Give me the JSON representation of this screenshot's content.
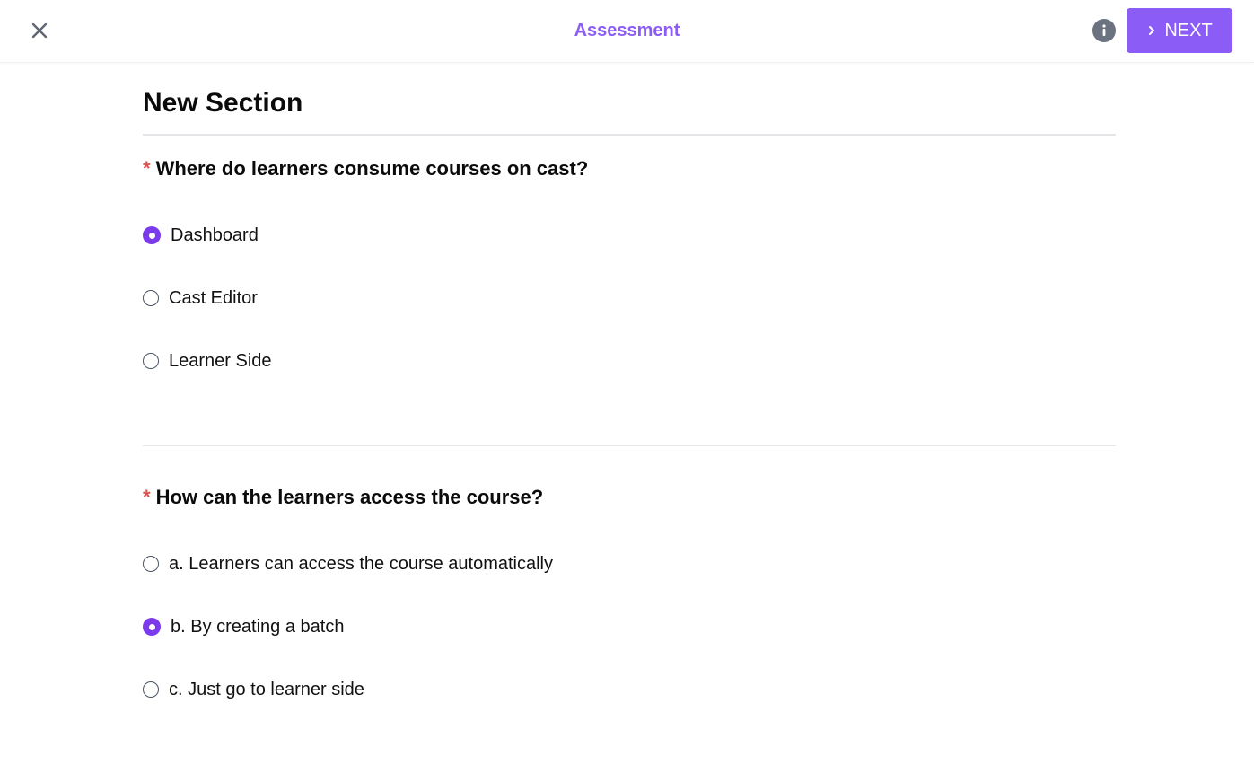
{
  "header": {
    "title": "Assessment",
    "next_label": "NEXT",
    "accent_color": "#8b5cf6",
    "close_icon": "close-icon",
    "info_icon": "info-icon",
    "next_icon": "chevron-right-icon"
  },
  "section": {
    "title": "New Section"
  },
  "questions": [
    {
      "required_marker": "*",
      "text": "Where do learners consume courses on cast?",
      "options": [
        {
          "label": "Dashboard",
          "selected": true
        },
        {
          "label": "Cast Editor",
          "selected": false
        },
        {
          "label": "Learner Side",
          "selected": false
        }
      ]
    },
    {
      "required_marker": "*",
      "text": "How can the learners access the course?",
      "options": [
        {
          "label": "a. Learners can access the course automatically",
          "selected": false
        },
        {
          "label": "b. By creating a batch",
          "selected": true
        },
        {
          "label": "c. Just go to learner side",
          "selected": false
        }
      ]
    }
  ]
}
